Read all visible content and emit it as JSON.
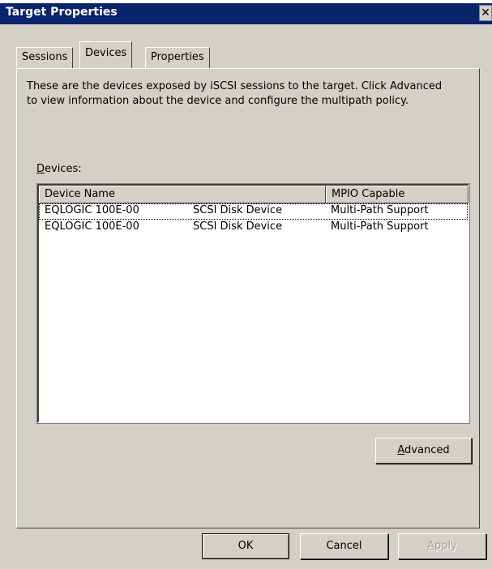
{
  "window": {
    "title": "Target Properties",
    "close_glyph": "✕"
  },
  "tabs": [
    {
      "label": "Sessions",
      "active": false
    },
    {
      "label": "Devices",
      "active": true
    },
    {
      "label": "Properties",
      "active": false
    }
  ],
  "panel": {
    "description": "These are the devices exposed by iSCSI sessions to the target. Click Advanced to view information about the device and configure the multipath policy.",
    "devices_label_mnemonic": "D",
    "devices_label_rest": "evices:",
    "columns": [
      "Device Name",
      "MPIO Capable"
    ],
    "rows": [
      {
        "vendor": "EQLOGIC  100E-00",
        "type": "SCSI Disk Device",
        "mpio": "Multi-Path Support"
      },
      {
        "vendor": "EQLOGIC  100E-00",
        "type": "SCSI Disk Device",
        "mpio": "Multi-Path Support"
      }
    ],
    "advanced_button": {
      "mnemonic": "A",
      "rest": "dvanced"
    }
  },
  "footer": {
    "ok": "OK",
    "cancel": "Cancel",
    "apply_mnemonic": "A",
    "apply_rest": "pply"
  },
  "colors": {
    "titlebar": "#08246b",
    "face": "#d4d0c8"
  }
}
